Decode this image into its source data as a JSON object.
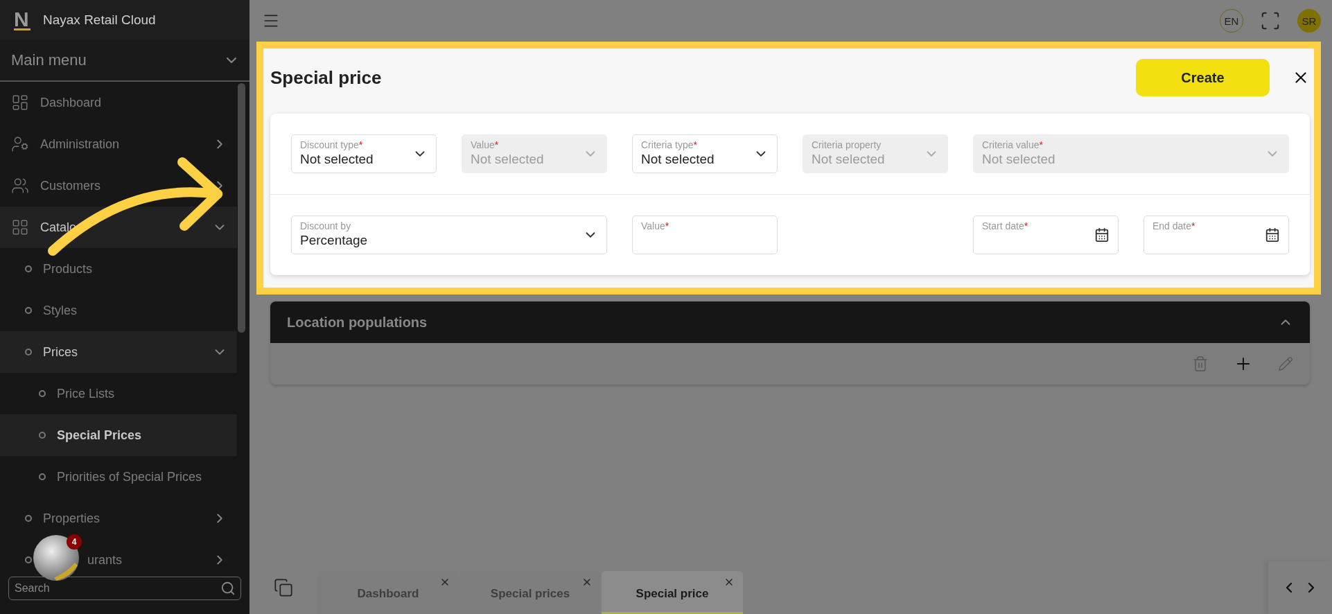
{
  "app": {
    "logo_letter": "N",
    "name": "Nayax Retail Cloud"
  },
  "sidebar": {
    "menu_title": "Main menu",
    "items": [
      {
        "label": "Dashboard",
        "selected": false
      },
      {
        "label": "Administration",
        "selected": false,
        "expanded": false
      },
      {
        "label": "Customers",
        "selected": false,
        "expanded": false
      },
      {
        "label": "Catalo",
        "selected": false,
        "expanded": true,
        "children": [
          {
            "label": "Products",
            "selected": false
          },
          {
            "label": "Styles",
            "selected": false
          },
          {
            "label": "Prices",
            "selected": false,
            "expanded": true,
            "children": [
              {
                "label": "Price Lists",
                "selected": false
              },
              {
                "label": "Special Prices",
                "selected": true
              },
              {
                "label": "Priorities of Special Prices",
                "selected": false
              }
            ]
          },
          {
            "label": "Properties",
            "selected": false,
            "expanded": false
          },
          {
            "label": "urants",
            "selected": false,
            "expanded": false
          }
        ]
      }
    ],
    "search": {
      "placeholder": "Search"
    }
  },
  "assistant": {
    "badge": "4"
  },
  "header": {
    "language": "EN",
    "user_initials": "SR"
  },
  "form": {
    "title": "Special price",
    "create_label": "Create",
    "criteria_fields": [
      {
        "kind": "select",
        "label": "Discount type",
        "required_mark": "*",
        "value": "Not selected",
        "disabled": false
      },
      {
        "kind": "select",
        "label": "Value",
        "required_mark": "*",
        "value": "Not selected",
        "disabled": true
      },
      {
        "kind": "select",
        "label": "Criteria type",
        "required_mark": "*",
        "value": "Not selected",
        "disabled": false
      },
      {
        "kind": "select",
        "label": "Criteria property",
        "value": "Not selected",
        "disabled": true
      },
      {
        "kind": "select",
        "label": "Criteria value",
        "required_mark": "*",
        "value": "Not selected",
        "disabled": true
      }
    ],
    "discount_fields": [
      {
        "kind": "select",
        "label": "Discount by",
        "value": "Percentage",
        "disabled": false
      },
      {
        "kind": "text",
        "label": "Value",
        "required_mark": "*",
        "disabled": false
      },
      {
        "kind": "date",
        "label": "Start date",
        "required_mark": "*",
        "disabled": false
      },
      {
        "kind": "date",
        "label": "End date",
        "required_mark": "*",
        "disabled": false
      }
    ]
  },
  "location_populations": {
    "title": "Location populations",
    "expanded": true
  },
  "tabs": [
    {
      "label": "Dashboard",
      "selected": false
    },
    {
      "label": "Special prices",
      "selected": false
    },
    {
      "label": "Special price",
      "selected": true
    }
  ]
}
